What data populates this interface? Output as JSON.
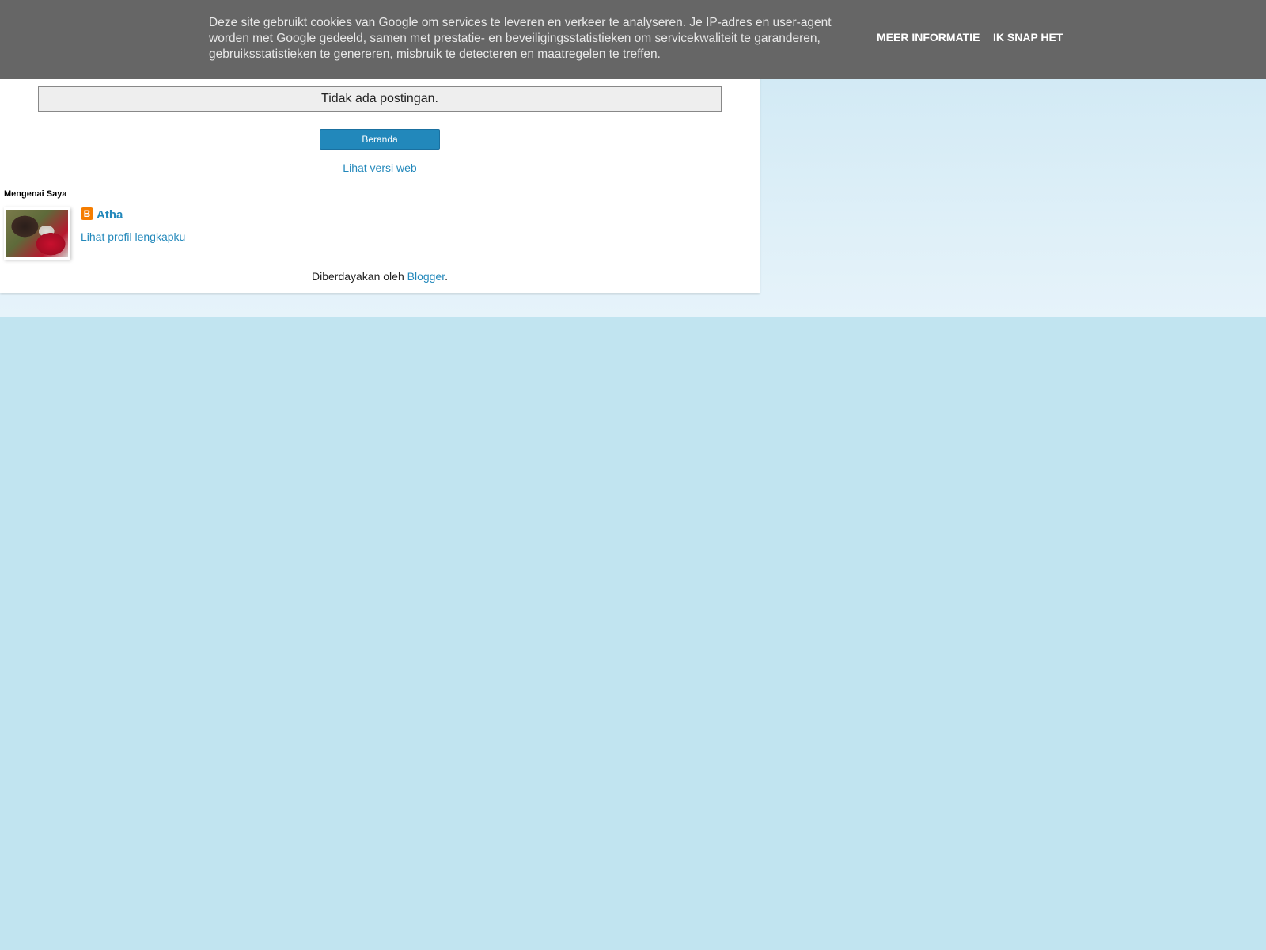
{
  "cookie_notice": {
    "message": "Deze site gebruikt cookies van Google om services te leveren en verkeer te analyseren. Je IP-adres en user-agent worden met Google gedeeld, samen met prestatie- en beveiligingsstatistieken om servicekwaliteit te garanderen, gebruiksstatistieken te genereren, misbruik te detecteren en maatregelen te treffen.",
    "more_info_label": "MEER INFORMATIE",
    "accept_label": "IK SNAP HET"
  },
  "main": {
    "status_message": "Tidak ada postingan.",
    "home_button_label": "Beranda",
    "web_version_link": "Lihat versi web"
  },
  "about": {
    "title": "Mengenai Saya",
    "name": "Atha",
    "profile_link": "Lihat profil lengkapku",
    "icon": "blogger-icon"
  },
  "footer": {
    "powered_prefix": "Diberdayakan oleh ",
    "powered_link": "Blogger",
    "powered_suffix": "."
  },
  "colors": {
    "page_background": "#c1e4f0",
    "link": "#2288bb",
    "cookie_bar": "#666666",
    "blogger_orange": "#f57d00"
  }
}
